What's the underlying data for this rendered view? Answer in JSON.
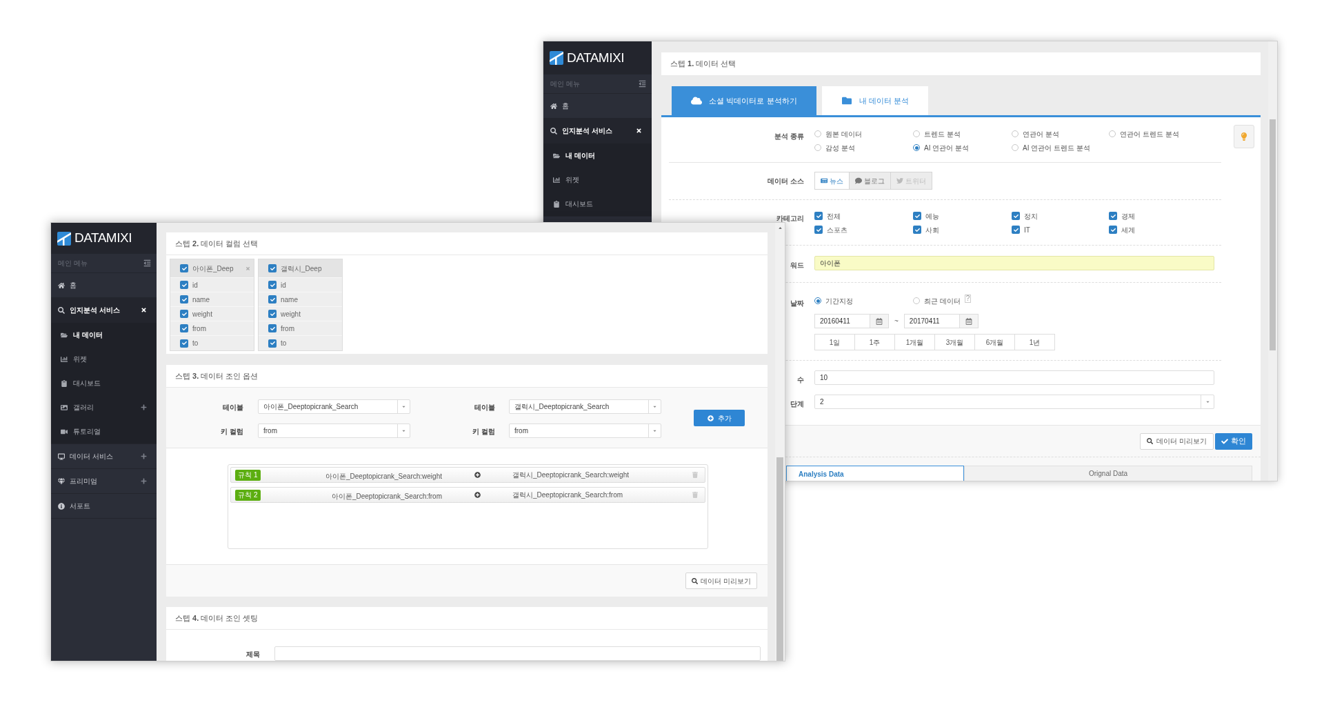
{
  "back_window": {
    "sidebar": {
      "logo": "DATAMIXI",
      "menu_label": "메인 메뉴",
      "items": [
        {
          "label": "홈",
          "kind": "link"
        },
        {
          "label": "인지분석 서비스",
          "kind": "group",
          "expanded": true,
          "children": [
            {
              "label": "내 데이터",
              "kind": "link",
              "selected": true
            },
            {
              "label": "위젯",
              "kind": "link",
              "selected": false
            },
            {
              "label": "대시보드",
              "kind": "link",
              "selected": false
            }
          ]
        }
      ]
    },
    "title": "스텝 **1.** 데이터 선택",
    "tabs": [
      {
        "label": "소셜 빅데이터로 분석하기",
        "selected": true
      },
      {
        "label": "내 데이터 분석",
        "selected": false
      }
    ],
    "form": {
      "analysis_type": {
        "label": "분석 종류",
        "options": [
          {
            "label": "원본 데이터",
            "selected": false
          },
          {
            "label": "트렌드 분석",
            "selected": false
          },
          {
            "label": "연관어 분석",
            "selected": false
          },
          {
            "label": "연관어 트렌드 분석",
            "selected": false
          },
          {
            "label": "감성 분석",
            "selected": false
          },
          {
            "label": "AI 연관어 분석",
            "selected": true
          },
          {
            "label": "AI 연관어 트렌드 분석",
            "selected": false
          }
        ]
      },
      "data_source": {
        "label": "데이터 소스",
        "options": [
          {
            "label": "뉴스",
            "selected": true,
            "disabled": false
          },
          {
            "label": "블로그",
            "selected": false,
            "disabled": false
          },
          {
            "label": "트위터",
            "selected": false,
            "disabled": true
          }
        ]
      },
      "category": {
        "label": "카테고리",
        "options": [
          {
            "label": "전체",
            "checked": true
          },
          {
            "label": "예능",
            "checked": true
          },
          {
            "label": "정치",
            "checked": true
          },
          {
            "label": "경제",
            "checked": true
          },
          {
            "label": "스포츠",
            "checked": true
          },
          {
            "label": "사회",
            "checked": true
          },
          {
            "label": "IT",
            "checked": true
          },
          {
            "label": "세계",
            "checked": true
          }
        ]
      },
      "keyword": {
        "label": "워드",
        "value": "아이폰"
      },
      "date": {
        "label": "날짜",
        "modes": [
          {
            "label": "기간지정",
            "selected": true
          },
          {
            "label": "최근 데이터",
            "selected": false
          }
        ],
        "help": "?",
        "from": "20160411",
        "separator": "~",
        "to": "20170411",
        "periods": [
          "1일",
          "1주",
          "1개월",
          "3개월",
          "6개월",
          "1년"
        ]
      },
      "result_count": {
        "label": "수",
        "value": "10"
      },
      "step": {
        "label": "단계",
        "value": "2"
      }
    },
    "preview_button": "데이터 미리보기",
    "confirm_button": "확인",
    "result_tabs": [
      {
        "label": "Analysis Data",
        "selected": true
      },
      {
        "label": "Orignal Data",
        "selected": false
      }
    ]
  },
  "front_window": {
    "sidebar": {
      "logo": "DATAMIXI",
      "menu_label": "메인 메뉴",
      "items": [
        {
          "label": "홈",
          "kind": "link"
        },
        {
          "label": "인지분석 서비스",
          "kind": "group",
          "expanded": true,
          "children": [
            {
              "label": "내 데이터",
              "kind": "link",
              "selected": true
            },
            {
              "label": "위젯",
              "kind": "link",
              "selected": false
            },
            {
              "label": "대시보드",
              "kind": "link",
              "selected": false
            },
            {
              "label": "갤러리",
              "kind": "group",
              "expanded": false,
              "selected": false
            },
            {
              "label": "튜토리얼",
              "kind": "link",
              "selected": false
            }
          ]
        },
        {
          "label": "데이터 서비스",
          "kind": "group",
          "expanded": false
        },
        {
          "label": "프리미엄",
          "kind": "group",
          "expanded": false
        },
        {
          "label": "서포트",
          "kind": "link"
        }
      ]
    },
    "step2": {
      "title": "스텝 **2.** 데이터 컬럼 선택",
      "tables": [
        {
          "name": "아이폰_Deep",
          "checked": true,
          "removable": true,
          "columns": [
            {
              "label": "id",
              "checked": true
            },
            {
              "label": "name",
              "checked": true
            },
            {
              "label": "weight",
              "checked": true
            },
            {
              "label": "from",
              "checked": true
            },
            {
              "label": "to",
              "checked": true
            }
          ]
        },
        {
          "name": "갤럭시_Deep",
          "checked": true,
          "removable": false,
          "columns": [
            {
              "label": "id",
              "checked": true
            },
            {
              "label": "name",
              "checked": true
            },
            {
              "label": "weight",
              "checked": true
            },
            {
              "label": "from",
              "checked": true
            },
            {
              "label": "to",
              "checked": true
            }
          ]
        }
      ]
    },
    "step3": {
      "title": "스텝 **3.** 데이터 조인 옵션",
      "sides": [
        {
          "table_label": "테이블",
          "table_value": "아이폰_Deeptopicrank_Search",
          "key_label": "키 컬럼",
          "key_value": "from"
        },
        {
          "table_label": "테이블",
          "table_value": "갤럭시_Deeptopicrank_Search",
          "key_label": "키 컬럼",
          "key_value": "from"
        }
      ],
      "add_button": "추가",
      "rules": [
        {
          "tag": "규칙 1",
          "left": "아이폰_Deeptopicrank_Search:weight",
          "right": "갤럭시_Deeptopicrank_Search:weight"
        },
        {
          "tag": "규칙 2",
          "left": "아이폰_Deeptopicrank_Search:from",
          "right": "갤럭시_Deeptopicrank_Search:from"
        }
      ],
      "preview_button": "데이터 미리보기"
    },
    "step4": {
      "title": "스텝 **4.** 데이터 조인 셋팅",
      "title_label": "제목"
    }
  }
}
